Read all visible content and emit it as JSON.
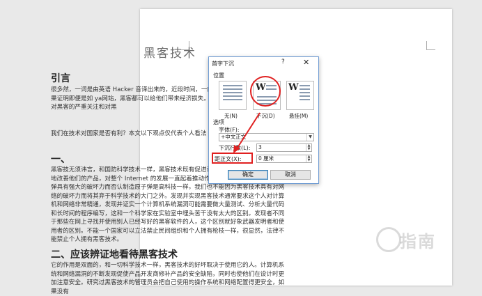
{
  "document": {
    "title": "黑客技术",
    "intro_heading": "引言",
    "intro_paragraph": "很多然，一词是由英语 Hacker 音译出来的，近段时间，一的大网站轮流考验了一番，结果证明即便是如 ya网站，黑客都可以给他们带来经济损失。这在一的信心，也引起了人们对黑客的严重关注和对黑",
    "intro_paragraph_2": "我们在技术对国家是否有利？本文以下观点仅代表个人看法",
    "heading1": "一、",
    "section1_paragraph": "黑客技无须讳言，和国防科学技术一样，黑客技术既有促进计算机和网络产品供应商不断地改善他们的产品，对整个 Internet 的发展一直起着推动作用。就象我们不能因为原子弹具有强大的破坏力而否认制造原子弹是高科技一样，我们也不能因为黑客技术具有对网络的破坏力而将其弃于科学技术的大门之外。发现并实现黑客技术通常要求这个人对计算机和网络非常精通，发现并证实一个计算机系统漏洞可能需要做大量测试、分析大量代码和长时间的程序编写，这和一个科学家在实验室中埋头苦干没有太大的区别。发现者不同于那些在网上寻找并使用别人已经写好的黑客软件的人，这个区别就好象武器发明者和使用者的区别。不能一个国家可以立法禁止民间组织和个人拥有枪枝一样，很显然，法律不能禁止个人拥有黑客技术。",
    "heading2": "二、应该辨证地看待黑客技术",
    "section2_paragraph": "它的作用是双面的，和一切科学技术一样，黑客技术的好坏取决于使用它的人。计算机系统和网络漏洞的不断发现促使产品开发商修补产品的安全缺陷，同时也使他们在设计时更加注意安全。研究过黑客技术的管理员会把自己使用的操作系统和网络配置得更安全，如果没有",
    "watermark_text": "指南"
  },
  "dialog": {
    "title": "首字下沉",
    "help_label": "?",
    "close_label": "✕",
    "position_section": "位置",
    "positions": [
      {
        "label": "无(N)",
        "selected": false
      },
      {
        "label": "下沉(D)",
        "selected": true
      },
      {
        "label": "悬挂(M)",
        "selected": false
      }
    ],
    "big_letter": "W",
    "options_section": "选项",
    "font_label": "字体(F):",
    "font_value": "+中文正文",
    "lines_label": "下沉行数(L):",
    "lines_value": "3",
    "distance_label": "距正文(X):",
    "distance_value": "0 厘米",
    "ok_label": "确定",
    "cancel_label": "取消"
  },
  "colors": {
    "highlight": "#e02020",
    "dialog_border": "#6e9bd3"
  }
}
